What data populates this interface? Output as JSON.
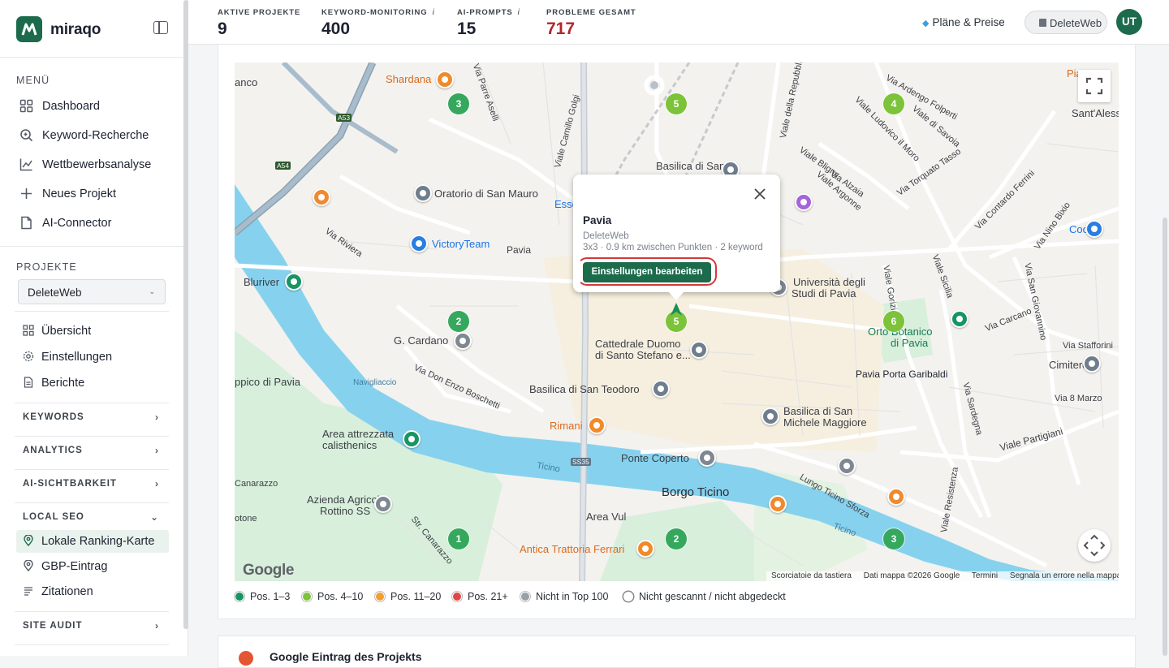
{
  "brand": {
    "name": "miraqo",
    "accent": "#1d6b4d"
  },
  "sidebar": {
    "menu_label": "MENÜ",
    "menu": [
      {
        "label": "Dashboard",
        "icon": "grid-icon"
      },
      {
        "label": "Keyword-Recherche",
        "icon": "search-icon"
      },
      {
        "label": "Wettbewerbsanalyse",
        "icon": "chart-line-icon"
      },
      {
        "label": "Neues Projekt",
        "icon": "plus-icon"
      },
      {
        "label": "AI-Connector",
        "icon": "document-icon"
      }
    ],
    "projects_label": "PROJEKTE",
    "project_select": "DeleteWeb",
    "project_items": [
      {
        "label": "Übersicht",
        "icon": "grid-icon"
      },
      {
        "label": "Einstellungen",
        "icon": "gear-icon"
      },
      {
        "label": "Berichte",
        "icon": "file-icon"
      }
    ],
    "groups": [
      {
        "label": "KEYWORDS",
        "expanded": false
      },
      {
        "label": "ANALYTICS",
        "expanded": false
      },
      {
        "label": "AI-SICHTBARKEIT",
        "expanded": false
      },
      {
        "label": "LOCAL SEO",
        "expanded": true
      },
      {
        "label": "SITE AUDIT",
        "expanded": false
      }
    ],
    "local_seo_items": [
      {
        "label": "Lokale Ranking-Karte",
        "icon": "pin-icon",
        "active": true
      },
      {
        "label": "GBP-Eintrag",
        "icon": "pin-icon",
        "active": false
      },
      {
        "label": "Zitationen",
        "icon": "list-icon",
        "active": false
      }
    ]
  },
  "topbar": {
    "stats": [
      {
        "label": "AKTIVE PROJEKTE",
        "value": "9",
        "info": false
      },
      {
        "label": "KEYWORD-MONITORING",
        "value": "400",
        "info": true
      },
      {
        "label": "AI-PROMPTS",
        "value": "15",
        "info": true
      },
      {
        "label": "PROBLEME GESAMT",
        "value": "717",
        "info": false,
        "color": "#b3262c"
      }
    ],
    "info_glyph": "i",
    "plans_label": "Pläne & Preise",
    "workspace_label": "DeleteWeb",
    "avatar_initials": "UT"
  },
  "map": {
    "labels": [
      "Shardana",
      "Oratorio di San Mauro",
      "VictoryTeam",
      "Pavia",
      "Bluriver",
      "G. Cardano",
      "Cattedrale Duomo",
      "di Santo Stefano e...",
      "Basilica di San Teodoro",
      "Rimani",
      "Area attrezzata",
      "calisthenics",
      "Ponte Coperto",
      "Borgo Ticino",
      "Area Vul",
      "Antica Trattoria Ferrari",
      "Azienda Agricola",
      "Rottino SS",
      "Università degli",
      "Studi di Pavia",
      "Orto Botanico",
      "di Pavia",
      "Pavia Porta Garibaldi",
      "Basilica di San",
      "Michele Maggiore",
      "Coop",
      "Cimitero",
      "Sant'Alessa",
      "Basilica di San",
      "Viale della Repubblica",
      "Via Torquato Tasso",
      "Viale Partigiani",
      "Lungo Ticino Sforza",
      "Ticino",
      "Via Riviera",
      "Viale Camillo Golgi",
      "Via Ardengo Folperti",
      "Viale Gorizia",
      "Via San Giovannino",
      "Viale Sicilia",
      "Via Carcano",
      "Via Stafforini",
      "Via Nino Bixio",
      "Via Contardo Ferrini",
      "Viale Resistenza",
      "Navigliaccio",
      "Via Don Enzo Boschetti",
      "Str. Canarazzo",
      "anco",
      "ppico di Pavia",
      "Canarazzo",
      "otone",
      "Piaz",
      "Via Sardegna",
      "Viale Argonne",
      "Viale Bligny",
      "Viale Ludovico il Moro",
      "Via Alzaia",
      "Via 8 Marzo",
      "Essel",
      "Viale di Savoia",
      "Via Parre Aselli",
      "SS35",
      "A53",
      "A54"
    ],
    "rank_markers": [
      {
        "label": "3",
        "tier": "1-3"
      },
      {
        "label": "5",
        "tier": "4-10"
      },
      {
        "label": "4",
        "tier": "4-10"
      },
      {
        "label": "2",
        "tier": "1-3"
      },
      {
        "label": "5",
        "tier": "4-10"
      },
      {
        "label": "6",
        "tier": "4-10"
      },
      {
        "label": "1",
        "tier": "1-3"
      },
      {
        "label": "2",
        "tier": "1-3"
      },
      {
        "label": "3",
        "tier": "1-3"
      }
    ],
    "popup": {
      "title": "Pavia",
      "subtitle": "DeleteWeb",
      "meta": "3x3 · 0.9 km zwischen Punkten · 2 keyword",
      "button": "Einstellungen bearbeiten"
    },
    "google_logo": "Google",
    "attribution": [
      "Scorciatoie da tastiera",
      "Dati mappa ©2026 Google",
      "Termini",
      "Segnala un errore nella mappa"
    ]
  },
  "legend": [
    {
      "label": "Pos. 1–3",
      "color": "#179463"
    },
    {
      "label": "Pos. 4–10",
      "color": "#7cc33a"
    },
    {
      "label": "Pos. 11–20",
      "color": "#f0a030"
    },
    {
      "label": "Pos. 21+",
      "color": "#e04848"
    },
    {
      "label": "Nicht in Top 100",
      "color": "#9aa0a8"
    },
    {
      "label": "Nicht gescannt / nicht abgedeckt",
      "color": "#ffffff"
    }
  ],
  "next_card": {
    "title": "Google Eintrag des Projekts"
  }
}
